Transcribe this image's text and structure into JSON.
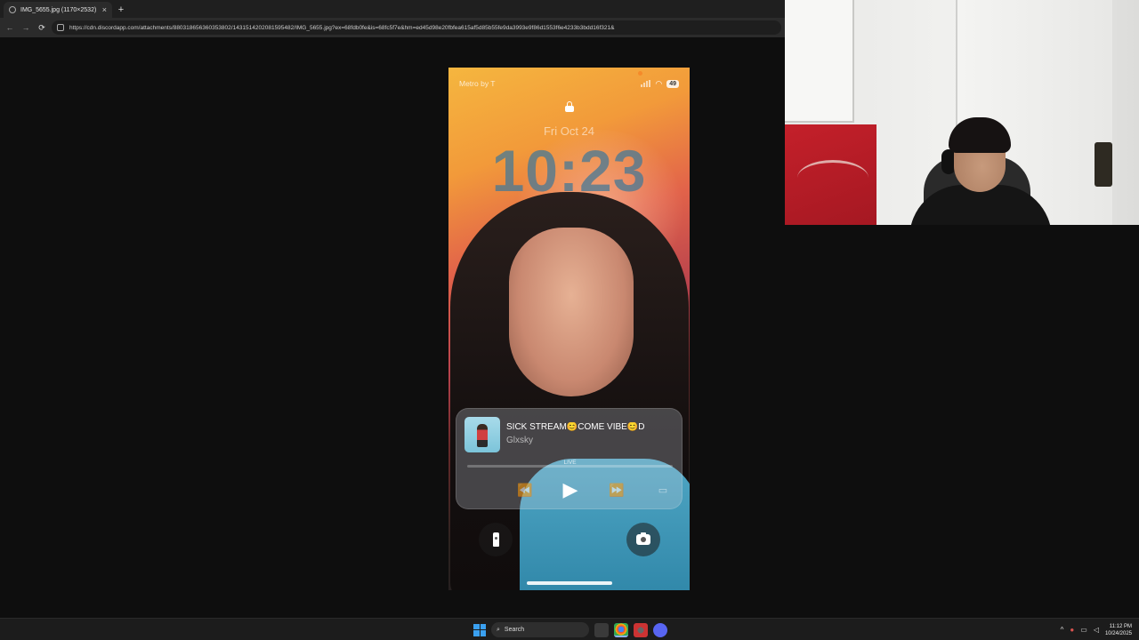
{
  "browser": {
    "tab_title": "IMG_5655.jpg (1170×2532)",
    "tab_close": "×",
    "new_tab": "+",
    "back": "←",
    "forward": "→",
    "reload": "⟳",
    "url": "https://cdn.discordapp.com/attachments/880318656360353802/1431514202081595482/IMG_5655.jpg?ex=68fdb0fe&is=68fc5f7e&hm=ed45d98e20fbfea615af5d85b55fe9da3993e9f86d1553f6e4233b3bdd16f321&"
  },
  "lockscreen": {
    "carrier": "Metro by T",
    "battery": "49",
    "date": "Fri Oct 24",
    "time": "10:23"
  },
  "now_playing": {
    "title": "SICK STREAM😊COME VIBE😊D",
    "artist": "Glxsky",
    "status": "LIVE",
    "rewind_icon": "⏪",
    "play_icon": "▶",
    "forward_icon": "⏩",
    "airplay_icon": "▭"
  },
  "taskbar": {
    "search_placeholder": "Search",
    "tray_chevron": "^",
    "time": "11:12 PM",
    "date": "10/24/2025"
  }
}
